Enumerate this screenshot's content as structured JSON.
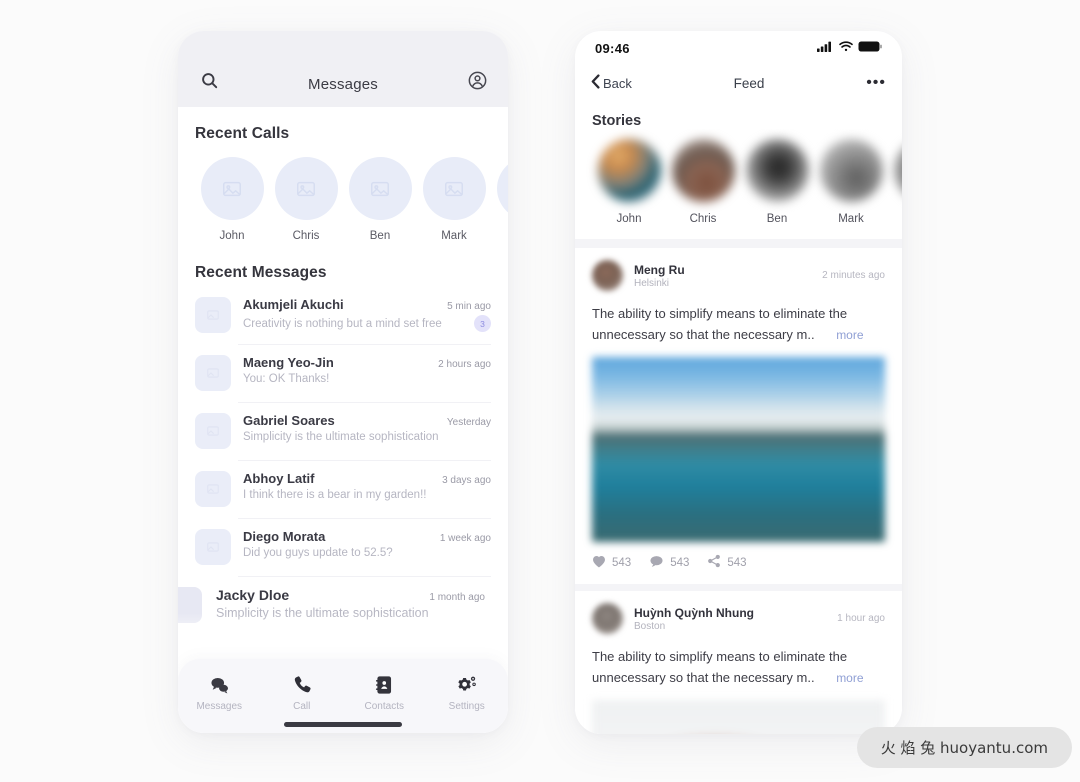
{
  "canvas": {
    "background": "#fbfbfb"
  },
  "left_phone": {
    "header": {
      "search_icon": "search-icon",
      "title": "Messages",
      "profile_icon": "user-circle-icon"
    },
    "recent_calls": {
      "title": "Recent Calls",
      "items": [
        {
          "name": "John"
        },
        {
          "name": "Chris"
        },
        {
          "name": "Ben"
        },
        {
          "name": "Mark"
        }
      ]
    },
    "recent_messages": {
      "title": "Recent Messages",
      "items": [
        {
          "name": "Akumjeli Akuchi",
          "preview": "Creativity is nothing but a mind set free",
          "time": "5 min ago",
          "badge": "3"
        },
        {
          "name": "Maeng Yeo-Jin",
          "preview": "You: OK Thanks!",
          "time": "2 hours ago",
          "badge": ""
        },
        {
          "name": "Gabriel Soares",
          "preview": "Simplicity is the ultimate sophistication",
          "time": "Yesterday",
          "badge": ""
        },
        {
          "name": "Abhoy Latif",
          "preview": "I think there is a bear in my garden!!",
          "time": "3 days ago",
          "badge": ""
        },
        {
          "name": "Diego Morata",
          "preview": "Did you guys update to 52.5?",
          "time": "1 week ago",
          "badge": ""
        },
        {
          "name": "Jacky Dloe",
          "preview": "Simplicity is the ultimate sophistication",
          "time": "1 month ago",
          "badge": ""
        }
      ]
    },
    "tabbar": {
      "items": [
        {
          "label": "Messages",
          "icon": "chat-bubbles-icon"
        },
        {
          "label": "Call",
          "icon": "phone-icon"
        },
        {
          "label": "Contacts",
          "icon": "contact-book-icon"
        },
        {
          "label": "Settings",
          "icon": "gears-icon"
        }
      ],
      "active": "Call"
    }
  },
  "right_phone": {
    "statusbar": {
      "time": "09:46",
      "signal_icon": "cellular-signal-icon",
      "wifi_icon": "wifi-icon",
      "battery_icon": "battery-full-icon"
    },
    "header": {
      "back_label": "Back",
      "back_icon": "chevron-left-icon",
      "title": "Feed",
      "more_icon": "ellipsis-icon",
      "more_label": "•••"
    },
    "stories": {
      "title": "Stories",
      "items": [
        {
          "name": "John",
          "colors": [
            "#d8a05e",
            "#2f5f6e",
            "#b9c6cf"
          ]
        },
        {
          "name": "Chris",
          "colors": [
            "#8b6f60",
            "#5c4a43",
            "#b5a79e"
          ]
        },
        {
          "name": "Ben",
          "colors": [
            "#3a3a3a",
            "#8e8e8e",
            "#d4d4d4"
          ]
        },
        {
          "name": "Mark",
          "colors": [
            "#6e6e6e",
            "#9d9d9d",
            "#c9c9c9"
          ]
        },
        {
          "name": "",
          "colors": [
            "#5a5a5a",
            "#8a8a8a",
            "#bcbcbc"
          ]
        }
      ]
    },
    "posts": [
      {
        "name": "Meng Ru",
        "location": "Helsinki",
        "time": "2 minutes ago",
        "text": "The ability to simplify means to eliminate the unnecessary so that the necessary m..",
        "more_label": "more",
        "has_image": true,
        "stats": [
          {
            "icon": "heart-icon",
            "value": "543"
          },
          {
            "icon": "comment-icon",
            "value": "543"
          },
          {
            "icon": "share-icon",
            "value": "543"
          }
        ]
      },
      {
        "name": "Huỳnh Quỳnh Nhung",
        "location": "Boston",
        "time": "1 hour ago",
        "text": "The ability to simplify means to eliminate the unnecessary so that the necessary m..",
        "more_label": "more",
        "has_image": true,
        "stats": []
      }
    ]
  },
  "watermark": {
    "text": "火 焰 兔  huoyantu.com"
  }
}
